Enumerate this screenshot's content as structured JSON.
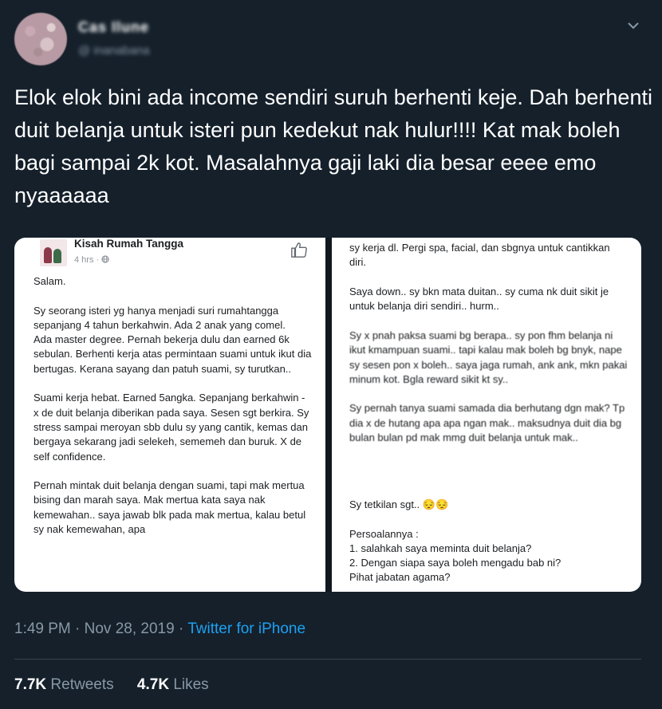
{
  "header": {
    "display_name": "Cas Ilune",
    "handle": "@ inanabana"
  },
  "tweet": {
    "text": "Elok elok bini ada income sendiri suruh berhenti keje. Dah berhenti duit belanja untuk isteri pun kedekut nak hulur!!!! Kat mak boleh bagi sampai 2k kot. Masalahnya gaji laki dia besar eeee emo nyaaaaaa"
  },
  "media": {
    "left_post": {
      "group_name": "Kisah Rumah Tangga",
      "time": "4 hrs ·",
      "body": "Salam.\n\nSy seorang isteri yg hanya menjadi suri rumahtangga sepanjang 4 tahun berkahwin. Ada 2 anak yang comel.\nAda master degree. Pernah bekerja dulu dan earned 6k sebulan. Berhenti kerja atas permintaan suami untuk ikut dia bertugas. Kerana sayang dan patuh suami, sy turutkan..\n\nSuami kerja hebat. Earned 5angka. Sepanjang berkahwin - x de duit belanja diberikan pada saya. Sesen sgt berkira.  Sy stress sampai meroyan sbb dulu sy yang cantik, kemas dan bergaya sekarang jadi selekeh, sememeh dan buruk. X de self confidence.\n\nPernah mintak duit belanja dengan suami, tapi mak mertua bising dan marah saya. Mak mertua kata saya nak kemewahan.. saya jawab blk pada mak mertua, kalau betul sy nak kemewahan, apa"
    },
    "right_post": {
      "body_top": "sy kerja dl. Pergi spa, facial, dan sbgnya untuk cantikkan diri.\n\nSaya down.. sy bkn mata duitan.. sy cuma nk duit sikit je untuk belanja diri sendiri.. hurm..\n\n",
      "body_blur": "Sy x pnah paksa suami bg berapa.. sy pon fhm belanja ni ikut kmampuan suami.. tapi kalau mak boleh bg bnyk, nape sy sesen pon x boleh.. saya jaga rumah, ank ank, mkn pakai minum kot. Bgla reward sikit kt sy..\n\nSy pernah tanya suami samada dia berhutang dgn mak? Tp dia x de hutang apa apa ngan mak.. maksudnya duit dia bg bulan bulan pd mak mmg duit belanja untuk mak..",
      "body_bottom": "Sy tetkilan sgt.. 😔😔\n\nPersoalannya :\n1. salahkah saya meminta duit belanja?\n2. Dengan siapa saya boleh mengadu bab ni?\nPihat jabatan agama?"
    }
  },
  "meta": {
    "time": "1:49 PM · Nov 28, 2019 · ",
    "source": "Twitter for iPhone"
  },
  "stats": {
    "retweets_count": "7.7K",
    "retweets_label": "Retweets",
    "likes_count": "4.7K",
    "likes_label": "Likes"
  },
  "colors": {
    "background": "#15202b",
    "link": "#1da1f2",
    "muted": "#8899a6"
  }
}
